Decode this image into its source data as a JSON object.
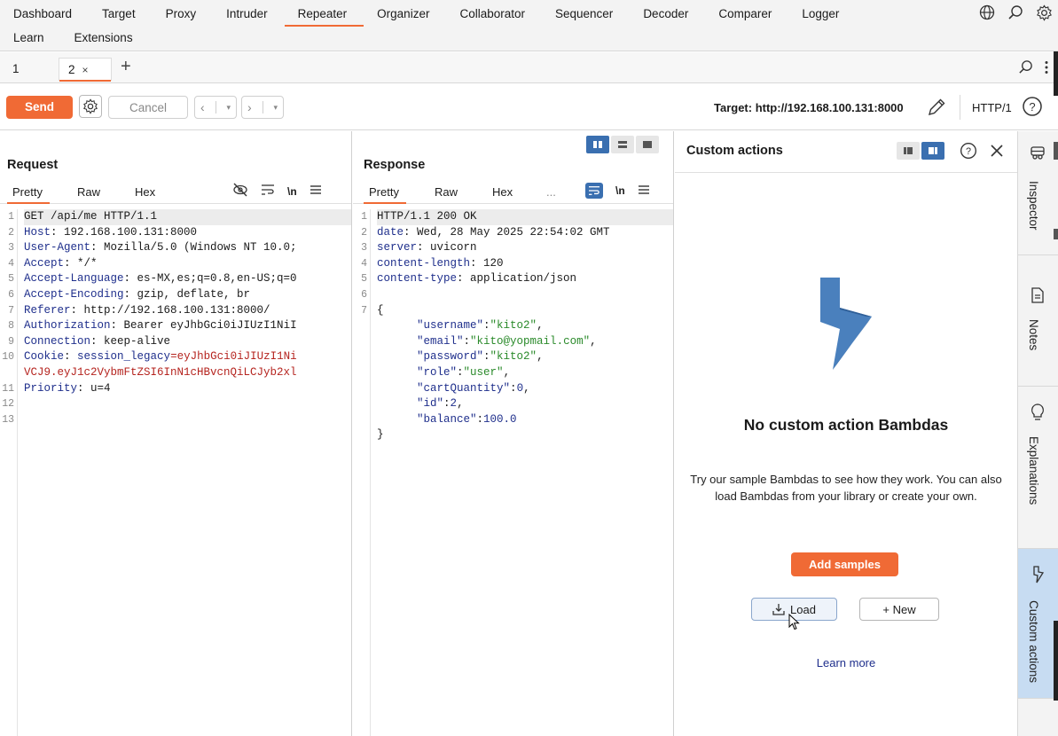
{
  "nav": {
    "row1": [
      "Dashboard",
      "Target",
      "Proxy",
      "Intruder",
      "Repeater",
      "Organizer",
      "Collaborator",
      "Sequencer",
      "Decoder",
      "Comparer",
      "Logger"
    ],
    "row2": [
      "Learn",
      "Extensions"
    ],
    "active": "Repeater",
    "icons": [
      "globe-icon",
      "search-icon",
      "settings-icon"
    ]
  },
  "subtabs": {
    "items": [
      {
        "label": "1"
      },
      {
        "label": "2",
        "close": "×"
      }
    ],
    "add": "+"
  },
  "toolbar": {
    "send": "Send",
    "cancel": "Cancel",
    "target": "Target: http://192.168.100.131:8000",
    "protocol": "HTTP/1"
  },
  "request": {
    "title": "Request",
    "tabs": [
      "Pretty",
      "Raw",
      "Hex"
    ],
    "lines": [
      {
        "n": "1",
        "segments": [
          {
            "t": "GET /api/me HTTP/1.1",
            "c": ""
          }
        ]
      },
      {
        "n": "2",
        "segments": [
          {
            "t": "Host",
            "c": "hn"
          },
          {
            "t": ": 192.168.100.131:8000",
            "c": ""
          }
        ]
      },
      {
        "n": "3",
        "segments": [
          {
            "t": "User-Agent",
            "c": "hn"
          },
          {
            "t": ": Mozilla/5.0 (Windows NT 10.0;",
            "c": ""
          }
        ]
      },
      {
        "n": "4",
        "segments": [
          {
            "t": "Accept",
            "c": "hn"
          },
          {
            "t": ": */*",
            "c": ""
          }
        ]
      },
      {
        "n": "5",
        "segments": [
          {
            "t": "Accept-Language",
            "c": "hn"
          },
          {
            "t": ": es-MX,es;q=0.8,en-US;q=0",
            "c": ""
          }
        ]
      },
      {
        "n": "6",
        "segments": [
          {
            "t": "Accept-Encoding",
            "c": "hn"
          },
          {
            "t": ": gzip, deflate, br",
            "c": ""
          }
        ]
      },
      {
        "n": "7",
        "segments": [
          {
            "t": "Referer",
            "c": "hn"
          },
          {
            "t": ": http://192.168.100.131:8000/",
            "c": ""
          }
        ]
      },
      {
        "n": "8",
        "segments": [
          {
            "t": "Authorization",
            "c": "hn"
          },
          {
            "t": ": Bearer eyJhbGci0iJIUzI1NiI",
            "c": ""
          }
        ]
      },
      {
        "n": "9",
        "segments": [
          {
            "t": "Connection",
            "c": "hn"
          },
          {
            "t": ": keep-alive",
            "c": ""
          }
        ]
      },
      {
        "n": "10",
        "segments": [
          {
            "t": "Cookie",
            "c": "hn"
          },
          {
            "t": ": ",
            "c": ""
          },
          {
            "t": "session_legacy",
            "c": "hn"
          },
          {
            "t": "=eyJhbGci0iJIUzI1Ni",
            "c": "red"
          }
        ]
      },
      {
        "n": "",
        "segments": [
          {
            "t": "VCJ9.eyJ1c2VybmFtZSI6InN1cHBvcnQiLCJyb2xl",
            "c": "red"
          }
        ]
      },
      {
        "n": "11",
        "segments": [
          {
            "t": "Priority",
            "c": "hn"
          },
          {
            "t": ": u=4",
            "c": ""
          }
        ]
      },
      {
        "n": "12",
        "segments": []
      },
      {
        "n": "13",
        "segments": []
      }
    ]
  },
  "response": {
    "title": "Response",
    "tabs": [
      "Pretty",
      "Raw",
      "Hex",
      "..."
    ],
    "lines": [
      {
        "n": "1",
        "segments": [
          {
            "t": "HTTP/1.1 200 OK",
            "c": ""
          }
        ]
      },
      {
        "n": "2",
        "segments": [
          {
            "t": "date",
            "c": "hn"
          },
          {
            "t": ": Wed, 28 May 2025 22:54:02 GMT",
            "c": ""
          }
        ]
      },
      {
        "n": "3",
        "segments": [
          {
            "t": "server",
            "c": "hn"
          },
          {
            "t": ": uvicorn",
            "c": ""
          }
        ]
      },
      {
        "n": "4",
        "segments": [
          {
            "t": "content-length",
            "c": "hn"
          },
          {
            "t": ": 120",
            "c": ""
          }
        ]
      },
      {
        "n": "5",
        "segments": [
          {
            "t": "content-type",
            "c": "hn"
          },
          {
            "t": ": application/json",
            "c": ""
          }
        ]
      },
      {
        "n": "6",
        "segments": []
      },
      {
        "n": "7",
        "segments": [
          {
            "t": "{",
            "c": ""
          }
        ]
      },
      {
        "n": "",
        "segments": [
          {
            "t": "      ",
            "c": ""
          },
          {
            "t": "\"username\"",
            "c": "key"
          },
          {
            "t": ":",
            "c": ""
          },
          {
            "t": "\"kito2\"",
            "c": "str"
          },
          {
            "t": ",",
            "c": ""
          }
        ]
      },
      {
        "n": "",
        "segments": [
          {
            "t": "      ",
            "c": ""
          },
          {
            "t": "\"email\"",
            "c": "key"
          },
          {
            "t": ":",
            "c": ""
          },
          {
            "t": "\"kito@yopmail.com\"",
            "c": "str"
          },
          {
            "t": ",",
            "c": ""
          }
        ]
      },
      {
        "n": "",
        "segments": [
          {
            "t": "      ",
            "c": ""
          },
          {
            "t": "\"password\"",
            "c": "key"
          },
          {
            "t": ":",
            "c": ""
          },
          {
            "t": "\"kito2\"",
            "c": "str"
          },
          {
            "t": ",",
            "c": ""
          }
        ]
      },
      {
        "n": "",
        "segments": [
          {
            "t": "      ",
            "c": ""
          },
          {
            "t": "\"role\"",
            "c": "key"
          },
          {
            "t": ":",
            "c": ""
          },
          {
            "t": "\"user\"",
            "c": "str"
          },
          {
            "t": ",",
            "c": ""
          }
        ]
      },
      {
        "n": "",
        "segments": [
          {
            "t": "      ",
            "c": ""
          },
          {
            "t": "\"cartQuantity\"",
            "c": "key"
          },
          {
            "t": ":",
            "c": ""
          },
          {
            "t": "0",
            "c": "num"
          },
          {
            "t": ",",
            "c": ""
          }
        ]
      },
      {
        "n": "",
        "segments": [
          {
            "t": "      ",
            "c": ""
          },
          {
            "t": "\"id\"",
            "c": "key"
          },
          {
            "t": ":",
            "c": ""
          },
          {
            "t": "2",
            "c": "num"
          },
          {
            "t": ",",
            "c": ""
          }
        ]
      },
      {
        "n": "",
        "segments": [
          {
            "t": "      ",
            "c": ""
          },
          {
            "t": "\"balance\"",
            "c": "key"
          },
          {
            "t": ":",
            "c": ""
          },
          {
            "t": "100.0",
            "c": "num"
          }
        ]
      },
      {
        "n": "",
        "segments": [
          {
            "t": "}",
            "c": ""
          }
        ]
      }
    ]
  },
  "custom_actions": {
    "title": "Custom actions",
    "heading": "No custom action Bambdas",
    "description": "Try our sample Bambdas to see how they work. You can also load Bambdas from your library or create your own.",
    "add_samples": "Add samples",
    "load": "Load",
    "new": "+ New",
    "learn_more": "Learn more"
  },
  "sidebar": {
    "items": [
      {
        "label": "Inspector",
        "icon": "inspector-icon"
      },
      {
        "label": "Notes",
        "icon": "notes-icon"
      },
      {
        "label": "Explanations",
        "icon": "lightbulb-icon"
      },
      {
        "label": "Custom actions",
        "icon": "bolt-icon"
      }
    ]
  },
  "colors": {
    "accent": "#f06a35",
    "header_name": "#1f2f8c",
    "cookie_value": "#b5241f",
    "json_string": "#2a8a2a",
    "active_sidebar": "#c7dcf2"
  }
}
